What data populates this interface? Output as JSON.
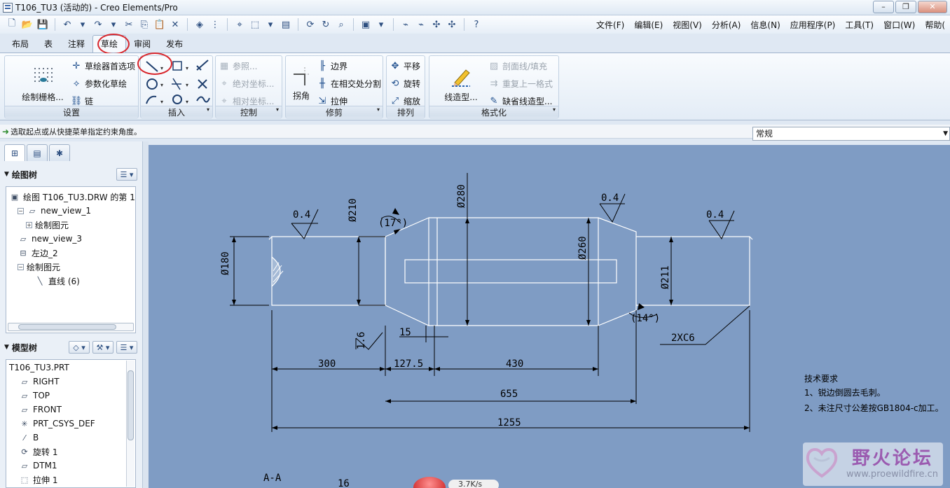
{
  "window": {
    "title": "T106_TU3 (活动的) - Creo Elements/Pro",
    "controls": [
      "–",
      "❐",
      "✕"
    ]
  },
  "menus": [
    "文件(F)",
    "编辑(E)",
    "视图(V)",
    "分析(A)",
    "信息(N)",
    "应用程序(P)",
    "工具(T)",
    "窗口(W)",
    "帮助("
  ],
  "ribbon_tabs": [
    "布局",
    "表",
    "注释",
    "草绘",
    "审阅",
    "发布"
  ],
  "active_tab": "草绘",
  "ribbon": {
    "settings": {
      "label": "设置",
      "grid_button": "绘制栅格...",
      "sketcher_prefs": "草绘器首选项",
      "param_sketch": "参数化草绘",
      "chain": "链"
    },
    "insert": {
      "label": "插入"
    },
    "control": {
      "label": "控制",
      "reference": "参照...",
      "absolute_coord": "绝对坐标...",
      "relative_coord": "相对坐标..."
    },
    "trim": {
      "label": "修剪",
      "corner": "拐角",
      "boundary": "边界",
      "split_at_intersect": "在相交处分割",
      "stretch": "拉伸"
    },
    "arrange": {
      "label": "排列",
      "translate": "平移",
      "rotate": "旋转",
      "scale": "缩放"
    },
    "format": {
      "label": "格式化",
      "line_style": "线造型...",
      "hatch_fill": "剖面线/填充",
      "repeat_format": "重复上一格式",
      "default_line_style": "缺省线造型..."
    }
  },
  "status": {
    "message": "选取起点或从快捷菜单指定约束角度。",
    "filter_value": "常规"
  },
  "drawing_tree": {
    "title": "绘图树",
    "items": [
      {
        "label": "绘图 T106_TU3.DRW 的第 1",
        "indent": 0,
        "icon": "drawing-icon",
        "expander": ""
      },
      {
        "label": "new_view_1",
        "indent": 1,
        "icon": "view-icon",
        "expander": "−"
      },
      {
        "label": "绘制图元",
        "indent": 2,
        "icon": "",
        "expander": "+"
      },
      {
        "label": "new_view_3",
        "indent": 1,
        "icon": "view-icon",
        "expander": ""
      },
      {
        "label": "左边_2",
        "indent": 1,
        "icon": "layout-icon",
        "expander": ""
      },
      {
        "label": "绘制图元",
        "indent": 1,
        "icon": "",
        "expander": "−"
      },
      {
        "label": "直线 (6)",
        "indent": 3,
        "icon": "line-icon",
        "expander": ""
      }
    ]
  },
  "model_tree": {
    "title": "模型树",
    "items": [
      {
        "label": "T106_TU3.PRT",
        "icon": "",
        "indent": 0
      },
      {
        "label": "RIGHT",
        "icon": "datum-plane-icon",
        "indent": 1
      },
      {
        "label": "TOP",
        "icon": "datum-plane-icon",
        "indent": 1
      },
      {
        "label": "FRONT",
        "icon": "datum-plane-icon",
        "indent": 1
      },
      {
        "label": "PRT_CSYS_DEF",
        "icon": "csys-icon",
        "indent": 1
      },
      {
        "label": "B",
        "icon": "axis-icon",
        "indent": 1
      },
      {
        "label": "旋转 1",
        "icon": "revolve-icon",
        "indent": 1
      },
      {
        "label": "DTM1",
        "icon": "datum-plane-icon",
        "indent": 1
      },
      {
        "label": "拉伸 1",
        "icon": "extrude-icon",
        "indent": 1
      }
    ]
  },
  "drawing": {
    "dims": {
      "d280": "Ø280",
      "d210": "Ø210",
      "d180": "Ø180",
      "d260": "Ø260",
      "d211": "Ø211",
      "angle1": "(17°)",
      "angle2": "(14°)",
      "l300": "300",
      "l1275": "127.5",
      "l430": "430",
      "l655": "655",
      "l1255": "1255",
      "l15": "15",
      "rough04a": "0.4",
      "rough04b": "0.4",
      "rough04c": "0.4",
      "rough16": "1.6",
      "chamfer": "2XC6",
      "section": "A-A",
      "partial16": "16"
    },
    "notes": {
      "title": "技术要求",
      "line1": "1、锐边倒圆去毛刺。",
      "line2": "2、未注尺寸公差按GB1804-c加工。"
    }
  },
  "watermark": {
    "title": "野火论坛",
    "url": "www.proewildfire.cn"
  },
  "overlay": {
    "speed": "3.7K/s"
  },
  "colors": {
    "canvas": "#7f9cc4",
    "highlight_circle": "#d8262c",
    "drawing_line": "#ffffff",
    "dim_line": "#000000"
  }
}
